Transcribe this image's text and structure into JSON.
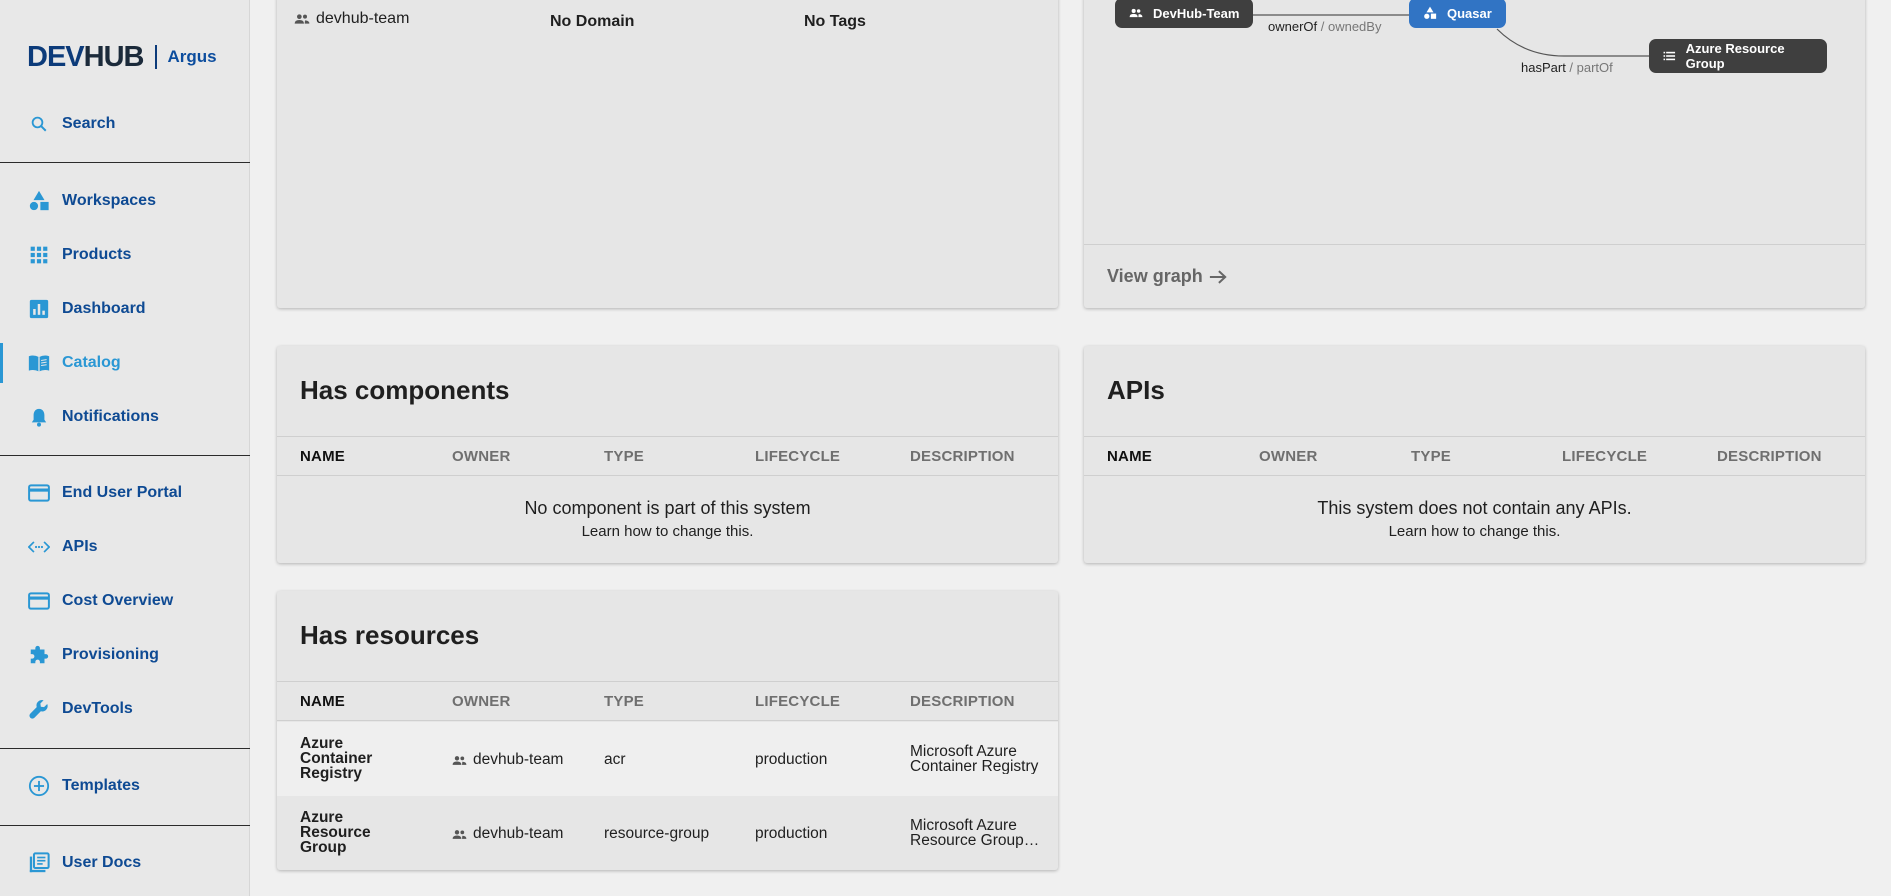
{
  "brand": {
    "logo_de": "DE",
    "logo_v": "V",
    "logo_hub": "HUB",
    "product": "Argus"
  },
  "sidebar": {
    "search": "Search",
    "workspaces": "Workspaces",
    "products": "Products",
    "dashboard": "Dashboard",
    "catalog": "Catalog",
    "notifications": "Notifications",
    "end_user_portal": "End User Portal",
    "apis": "APIs",
    "cost_overview": "Cost Overview",
    "provisioning": "Provisioning",
    "devtools": "DevTools",
    "templates": "Templates",
    "user_docs": "User Docs"
  },
  "about": {
    "owner": "devhub-team",
    "domain": "No Domain",
    "tags": "No Tags"
  },
  "graph": {
    "node_team": "DevHub-Team",
    "node_system": "Quasar",
    "node_resource": "Azure Resource Group",
    "edge1_main": "ownerOf",
    "edge1_sub": " / ownedBy",
    "edge2_main": "hasPart",
    "edge2_sub": " / partOf",
    "view_graph": "View graph"
  },
  "components": {
    "title": "Has components",
    "columns": [
      "NAME",
      "OWNER",
      "TYPE",
      "LIFECYCLE",
      "DESCRIPTION"
    ],
    "empty_title": "No component is part of this system",
    "empty_hint": "Learn how to change this."
  },
  "apis": {
    "title": "APIs",
    "columns": [
      "NAME",
      "OWNER",
      "TYPE",
      "LIFECYCLE",
      "DESCRIPTION"
    ],
    "empty_title": "This system does not contain any APIs.",
    "empty_hint": "Learn how to change this."
  },
  "resources": {
    "title": "Has resources",
    "columns": [
      "NAME",
      "OWNER",
      "TYPE",
      "LIFECYCLE",
      "DESCRIPTION"
    ],
    "rows": [
      {
        "name": "Azure Container Registry",
        "owner": "devhub-team",
        "type": "acr",
        "lifecycle": "production",
        "description_l1": "Microsoft Azure",
        "description_l2": "Container Registry"
      },
      {
        "name": "Azure Resource Group",
        "owner": "devhub-team",
        "type": "resource-group",
        "lifecycle": "production",
        "description_l1": "Microsoft Azure",
        "description_l2": "Resource Group: quasar"
      }
    ]
  }
}
